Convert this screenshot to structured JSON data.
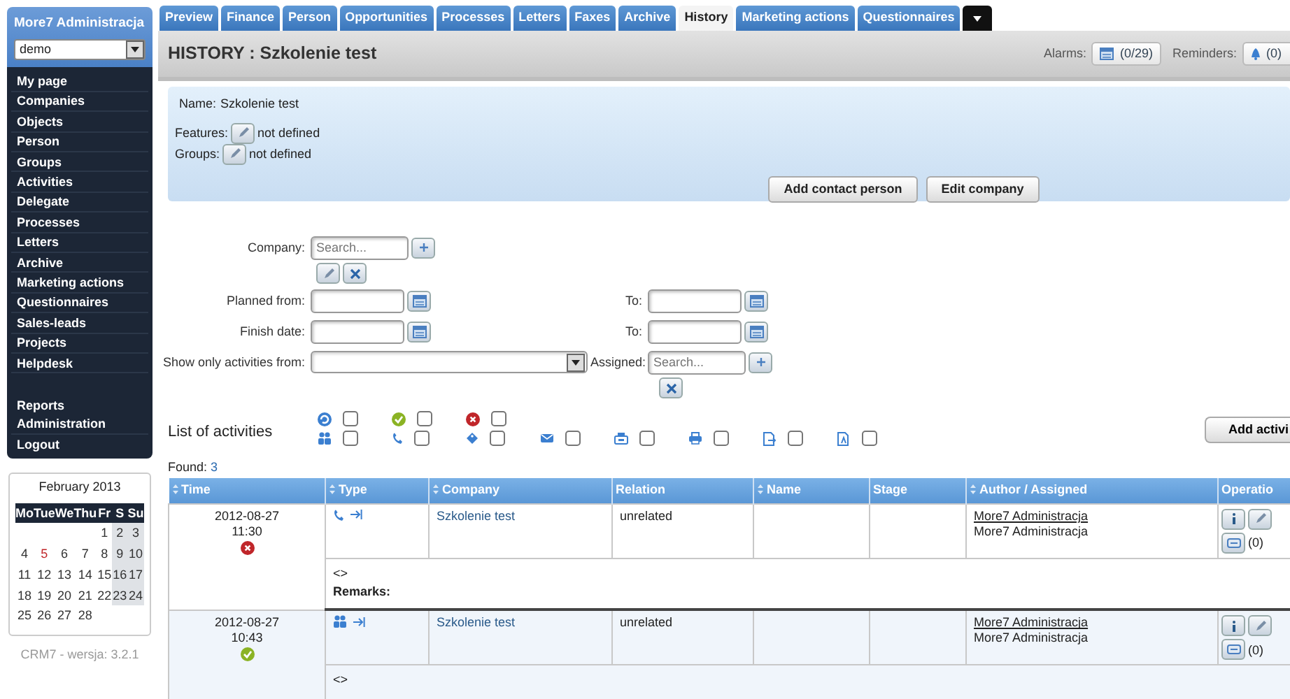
{
  "user": {
    "name": "More7 Administracja",
    "select": "demo"
  },
  "menu_groups": [
    {
      "items": [
        "My page",
        "Companies",
        "Objects",
        "Person",
        "Groups",
        "Activities",
        "Delegate",
        "Processes",
        "Letters",
        "Archive",
        "Marketing actions",
        "Questionnaires",
        "Sales-leads",
        "Projects",
        "Helpdesk"
      ]
    },
    {
      "items": [
        "Reports",
        "Administration"
      ]
    },
    {
      "items": [
        "Logout"
      ]
    }
  ],
  "calendar": {
    "title": "February 2013",
    "weekdays": [
      "Mo",
      "Tue",
      "We",
      "Thu",
      "Fr",
      "S",
      "Su"
    ],
    "weeks": [
      {
        "kind": "end",
        "days": [
          {
            "d": "1",
            "today": false
          },
          {
            "d": "2",
            "today": false
          },
          {
            "d": "3",
            "today": false
          }
        ]
      },
      {
        "kind": "start",
        "days": [
          {
            "d": "4",
            "today": false
          },
          {
            "d": "5",
            "today": true
          },
          {
            "d": "6",
            "today": false
          },
          {
            "d": "7",
            "today": false
          },
          {
            "d": "8",
            "today": false
          },
          {
            "d": "9",
            "today": false
          },
          {
            "d": "10",
            "today": false
          }
        ]
      },
      {
        "kind": "start",
        "days": [
          {
            "d": "11",
            "today": false
          },
          {
            "d": "12",
            "today": false
          },
          {
            "d": "13",
            "today": false
          },
          {
            "d": "14",
            "today": false
          },
          {
            "d": "15",
            "today": false
          },
          {
            "d": "16",
            "today": false
          },
          {
            "d": "17",
            "today": false
          }
        ]
      },
      {
        "kind": "start",
        "days": [
          {
            "d": "18",
            "today": false
          },
          {
            "d": "19",
            "today": false
          },
          {
            "d": "20",
            "today": false
          },
          {
            "d": "21",
            "today": false
          },
          {
            "d": "22",
            "today": false
          },
          {
            "d": "23",
            "today": false
          },
          {
            "d": "24",
            "today": false
          }
        ]
      },
      {
        "kind": "start",
        "days": [
          {
            "d": "25",
            "today": false
          },
          {
            "d": "26",
            "today": false
          },
          {
            "d": "27",
            "today": false
          },
          {
            "d": "28",
            "today": false
          }
        ]
      }
    ]
  },
  "version": "CRM7 - wersja: 3.2.1",
  "tabs": [
    {
      "label": "Preview",
      "selected": false
    },
    {
      "label": "Finance",
      "selected": false
    },
    {
      "label": "Person",
      "selected": false
    },
    {
      "label": "Opportunities",
      "selected": false
    },
    {
      "label": "Processes",
      "selected": false
    },
    {
      "label": "Letters",
      "selected": false
    },
    {
      "label": "Faxes",
      "selected": false
    },
    {
      "label": "Archive",
      "selected": false
    },
    {
      "label": "History",
      "selected": true
    },
    {
      "label": "Marketing actions",
      "selected": false
    },
    {
      "label": "Questionnaires",
      "selected": false
    }
  ],
  "header": {
    "title": "HISTORY : Szkolenie test",
    "alarms_label": "Alarms:",
    "alarms_count": "(0/29)",
    "reminders_label": "Reminders:",
    "reminders_count": "(0)"
  },
  "info": {
    "name_label": "Name:",
    "name": "Szkolenie test",
    "fields": [
      {
        "label": "Features:",
        "value": "not defined"
      },
      {
        "label": "Groups:",
        "value": "not defined"
      }
    ],
    "buttons": [
      "Add contact person",
      "Edit company"
    ]
  },
  "filters": {
    "company_label": "Company:",
    "company_placeholder": "Search...",
    "planned_label": "Planned from:",
    "planned_to_label": "To:",
    "finish_label": "Finish date:",
    "finish_to_label": "To:",
    "show_label": "Show only activities from:",
    "assigned_label": "Assigned:",
    "assigned_placeholder": "Search..."
  },
  "activities": {
    "title": "List of activities",
    "add_button": "Add activi",
    "filter_rows": [
      [
        {
          "kind": "planned",
          "checked": false
        },
        {
          "kind": "done",
          "checked": false
        },
        {
          "kind": "cancelled",
          "checked": false
        }
      ],
      [
        {
          "kind": "meeting",
          "checked": false
        },
        {
          "kind": "phone",
          "checked": false
        },
        {
          "kind": "note",
          "checked": false
        },
        {
          "kind": "email",
          "checked": false
        },
        {
          "kind": "fax",
          "checked": false
        },
        {
          "kind": "print",
          "checked": false
        },
        {
          "kind": "doc_out",
          "checked": false
        },
        {
          "kind": "doc_in",
          "checked": false
        }
      ]
    ]
  },
  "found_label": "Found:",
  "found_count": "3",
  "table": {
    "columns": [
      {
        "label": "Time",
        "sortable": true
      },
      {
        "label": "Type",
        "sortable": true
      },
      {
        "label": "Company",
        "sortable": true
      },
      {
        "label": "Relation",
        "sortable": false
      },
      {
        "label": "Name",
        "sortable": true
      },
      {
        "label": "Stage",
        "sortable": false
      },
      {
        "label": "Author / Assigned",
        "sortable": true
      },
      {
        "label": "Operatio",
        "sortable": false
      }
    ],
    "rows": [
      {
        "date": "2012-08-27",
        "time": "11:30",
        "status": {
          "kind": "cancelled"
        },
        "type": {
          "kind": "phone"
        },
        "company": "Szkolenie test",
        "relation": "unrelated",
        "author": "More7 Administracja",
        "assigned": "More7 Administracja",
        "comments": "(0)",
        "remark_marker": "<>",
        "remarks_label": "Remarks:"
      },
      {
        "date": "2012-08-27",
        "time": "10:43",
        "status": {
          "kind": "done"
        },
        "type": {
          "kind": "meeting"
        },
        "company": "Szkolenie test",
        "relation": "unrelated",
        "author": "More7 Administracja",
        "assigned": "More7 Administracja",
        "comments": "(0)",
        "remark_marker": "<>"
      }
    ]
  }
}
